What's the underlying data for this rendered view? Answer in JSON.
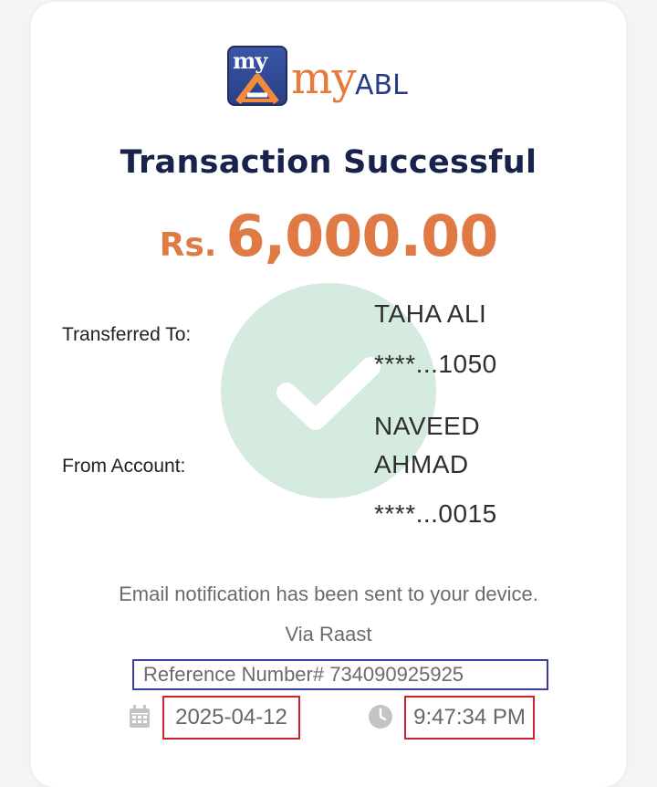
{
  "logo": {
    "box_text": "my",
    "brand_my": "my",
    "brand_abl": "ABL",
    "colors": {
      "orange": "#e57a3c",
      "navy": "#243b8a"
    }
  },
  "title": "Transaction Successful",
  "amount": {
    "currency": "Rs.",
    "value": "6,000.00"
  },
  "transferred_to": {
    "label": "Transferred To:",
    "name": "TAHA ALI",
    "account": "****...1050"
  },
  "from_account": {
    "label": "From Account:",
    "name_line1": "NAVEED",
    "name_line2": "AHMAD",
    "account": "****...0015"
  },
  "notification": "Email notification has been sent to your device.",
  "via": "Via Raast",
  "reference": "Reference Number# 734090925925",
  "date": "2025-04-12",
  "time": "9:47:34 PM",
  "icons": {
    "success": "check-icon",
    "date": "calendar-icon",
    "time": "clock-icon"
  }
}
